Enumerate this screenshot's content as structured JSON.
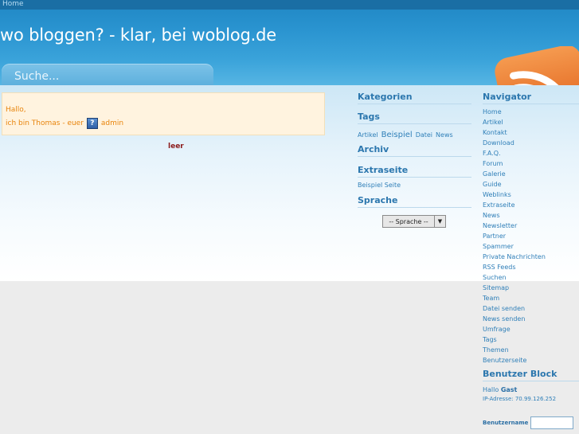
{
  "header": {
    "home_link": "Home",
    "site_title": "wo bloggen? - klar, bei woblog.de",
    "search_placeholder": "Suche..."
  },
  "main": {
    "welcome_line1": "Hallo,",
    "welcome_line2": "ich bin Thomas - euer",
    "welcome_role": "admin",
    "empty_text": "leer"
  },
  "middle": {
    "kategorien_title": "Kategorien",
    "tags_title": "Tags",
    "tags": [
      {
        "label": "Artikel",
        "size": "small"
      },
      {
        "label": "Beispiel",
        "size": "big"
      },
      {
        "label": "Datei",
        "size": "small"
      },
      {
        "label": "News",
        "size": "small"
      }
    ],
    "archiv_title": "Archiv",
    "extraseite_title": "Extraseite",
    "extraseite_link": "Beispiel Seite",
    "sprache_title": "Sprache",
    "sprache_select": "-- Sprache --"
  },
  "navigator": {
    "title": "Navigator",
    "items": [
      "Home",
      "Artikel",
      "Kontakt",
      "Download",
      "F.A.Q.",
      "Forum",
      "Galerie",
      "Guide",
      "Weblinks",
      "Extraseite",
      "News",
      "Newsletter",
      "Partner",
      "Spammer",
      "Private Nachrichten",
      "RSS Feeds",
      "Suchen",
      "Sitemap",
      "Team",
      "Datei senden",
      "News senden",
      "Umfrage",
      "Tags",
      "Themen",
      "Benutzerseite"
    ]
  },
  "userblock": {
    "title": "Benutzer Block",
    "hallo": "Hallo",
    "guest": "Gast",
    "ip": "IP-Adresse: 70.99.126.252",
    "username_label": "Benutzername"
  },
  "colors": {
    "header_blue": "#2a94d0",
    "link_blue": "#2f7fb8",
    "welcome_orange": "#e8840c",
    "rss_orange": "#f07a2a"
  }
}
